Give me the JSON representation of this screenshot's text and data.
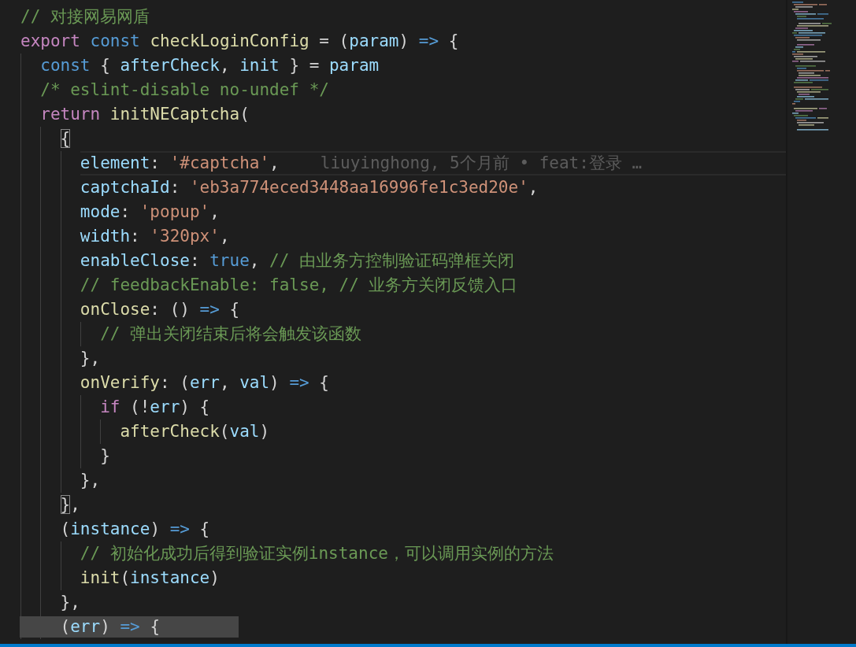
{
  "editor": {
    "lines": [
      {
        "tokens": [
          {
            "kind": "comment",
            "text": "// 对接网易网盾"
          }
        ]
      },
      {
        "tokens": [
          {
            "kind": "control",
            "text": "export "
          },
          {
            "kind": "keyword",
            "text": "const "
          },
          {
            "kind": "function",
            "text": "checkLoginConfig"
          },
          {
            "kind": "punct",
            "text": " = ("
          },
          {
            "kind": "variable",
            "text": "param"
          },
          {
            "kind": "punct",
            "text": ") "
          },
          {
            "kind": "keyword",
            "text": "=>"
          },
          {
            "kind": "punct",
            "text": " {"
          }
        ],
        "children": [
          {
            "tokens": [
              {
                "kind": "keyword",
                "text": "const "
              },
              {
                "kind": "punct",
                "text": "{ "
              },
              {
                "kind": "variable",
                "text": "afterCheck"
              },
              {
                "kind": "punct",
                "text": ", "
              },
              {
                "kind": "variable",
                "text": "init"
              },
              {
                "kind": "punct",
                "text": " } = "
              },
              {
                "kind": "variable",
                "text": "param"
              }
            ]
          },
          {
            "tokens": [
              {
                "kind": "comment",
                "text": "/* eslint-disable no-undef */"
              }
            ]
          },
          {
            "tokens": [
              {
                "kind": "control",
                "text": "return "
              },
              {
                "kind": "function",
                "text": "initNECaptcha"
              },
              {
                "kind": "punct",
                "text": "("
              }
            ],
            "children": [
              {
                "tokens": [
                  {
                    "kind": "punct",
                    "text": "{",
                    "matched": true
                  }
                ],
                "children": [
                  {
                    "current": true,
                    "tokens": [
                      {
                        "kind": "property",
                        "text": "element"
                      },
                      {
                        "kind": "punct",
                        "text": ": "
                      },
                      {
                        "kind": "string",
                        "text": "'#captcha'"
                      },
                      {
                        "kind": "punct",
                        "text": ","
                      }
                    ],
                    "blame": "liuyinghong, 5个月前 • feat:登录 …"
                  },
                  {
                    "tokens": [
                      {
                        "kind": "property",
                        "text": "captchaId"
                      },
                      {
                        "kind": "punct",
                        "text": ": "
                      },
                      {
                        "kind": "string",
                        "text": "'eb3a774eced3448aa16996fe1c3ed20e'"
                      },
                      {
                        "kind": "punct",
                        "text": ","
                      }
                    ]
                  },
                  {
                    "tokens": [
                      {
                        "kind": "property",
                        "text": "mode"
                      },
                      {
                        "kind": "punct",
                        "text": ": "
                      },
                      {
                        "kind": "string",
                        "text": "'popup'"
                      },
                      {
                        "kind": "punct",
                        "text": ","
                      }
                    ]
                  },
                  {
                    "tokens": [
                      {
                        "kind": "property",
                        "text": "width"
                      },
                      {
                        "kind": "punct",
                        "text": ": "
                      },
                      {
                        "kind": "string",
                        "text": "'320px'"
                      },
                      {
                        "kind": "punct",
                        "text": ","
                      }
                    ]
                  },
                  {
                    "tokens": [
                      {
                        "kind": "property",
                        "text": "enableClose"
                      },
                      {
                        "kind": "punct",
                        "text": ": "
                      },
                      {
                        "kind": "keyword",
                        "text": "true"
                      },
                      {
                        "kind": "punct",
                        "text": ", "
                      },
                      {
                        "kind": "comment",
                        "text": "// 由业务方控制验证码弹框关闭"
                      }
                    ]
                  },
                  {
                    "tokens": [
                      {
                        "kind": "comment",
                        "text": "// feedbackEnable: false, // 业务方关闭反馈入口"
                      }
                    ]
                  },
                  {
                    "tokens": [
                      {
                        "kind": "function",
                        "text": "onClose"
                      },
                      {
                        "kind": "punct",
                        "text": ": () "
                      },
                      {
                        "kind": "keyword",
                        "text": "=>"
                      },
                      {
                        "kind": "punct",
                        "text": " {"
                      }
                    ],
                    "children": [
                      {
                        "tokens": [
                          {
                            "kind": "comment",
                            "text": "// 弹出关闭结束后将会触发该函数"
                          }
                        ]
                      }
                    ]
                  },
                  {
                    "tokens": [
                      {
                        "kind": "punct",
                        "text": "},"
                      }
                    ]
                  },
                  {
                    "tokens": [
                      {
                        "kind": "function",
                        "text": "onVerify"
                      },
                      {
                        "kind": "punct",
                        "text": ": ("
                      },
                      {
                        "kind": "variable",
                        "text": "err"
                      },
                      {
                        "kind": "punct",
                        "text": ", "
                      },
                      {
                        "kind": "variable",
                        "text": "val"
                      },
                      {
                        "kind": "punct",
                        "text": ") "
                      },
                      {
                        "kind": "keyword",
                        "text": "=>"
                      },
                      {
                        "kind": "punct",
                        "text": " {"
                      }
                    ],
                    "children": [
                      {
                        "tokens": [
                          {
                            "kind": "control",
                            "text": "if "
                          },
                          {
                            "kind": "punct",
                            "text": "(!"
                          },
                          {
                            "kind": "variable",
                            "text": "err"
                          },
                          {
                            "kind": "punct",
                            "text": ") {"
                          }
                        ],
                        "children": [
                          {
                            "tokens": [
                              {
                                "kind": "function",
                                "text": "afterCheck"
                              },
                              {
                                "kind": "punct",
                                "text": "("
                              },
                              {
                                "kind": "variable",
                                "text": "val"
                              },
                              {
                                "kind": "punct",
                                "text": ")"
                              }
                            ]
                          }
                        ]
                      },
                      {
                        "tokens": [
                          {
                            "kind": "punct",
                            "text": "}"
                          }
                        ]
                      }
                    ]
                  },
                  {
                    "tokens": [
                      {
                        "kind": "punct",
                        "text": "},"
                      }
                    ]
                  }
                ]
              },
              {
                "tokens": [
                  {
                    "kind": "punct",
                    "text": "}",
                    "matched": true
                  },
                  {
                    "kind": "punct",
                    "text": ","
                  }
                ]
              },
              {
                "tokens": [
                  {
                    "kind": "punct",
                    "text": "("
                  },
                  {
                    "kind": "variable",
                    "text": "instance"
                  },
                  {
                    "kind": "punct",
                    "text": ") "
                  },
                  {
                    "kind": "keyword",
                    "text": "=>"
                  },
                  {
                    "kind": "punct",
                    "text": " {"
                  }
                ],
                "children": [
                  {
                    "tokens": [
                      {
                        "kind": "comment",
                        "text": "// 初始化成功后得到验证实例instance，可以调用实例的方法"
                      }
                    ]
                  },
                  {
                    "tokens": [
                      {
                        "kind": "function",
                        "text": "init"
                      },
                      {
                        "kind": "punct",
                        "text": "("
                      },
                      {
                        "kind": "variable",
                        "text": "instance"
                      },
                      {
                        "kind": "punct",
                        "text": ")"
                      }
                    ]
                  }
                ]
              },
              {
                "tokens": [
                  {
                    "kind": "punct",
                    "text": "},"
                  }
                ]
              },
              {
                "selected": true,
                "tokens": [
                  {
                    "kind": "punct",
                    "text": "("
                  },
                  {
                    "kind": "variable",
                    "text": "err"
                  },
                  {
                    "kind": "punct",
                    "text": ") "
                  },
                  {
                    "kind": "keyword",
                    "text": "=>"
                  },
                  {
                    "kind": "punct",
                    "text": " {"
                  }
                ]
              }
            ]
          }
        ]
      }
    ]
  }
}
